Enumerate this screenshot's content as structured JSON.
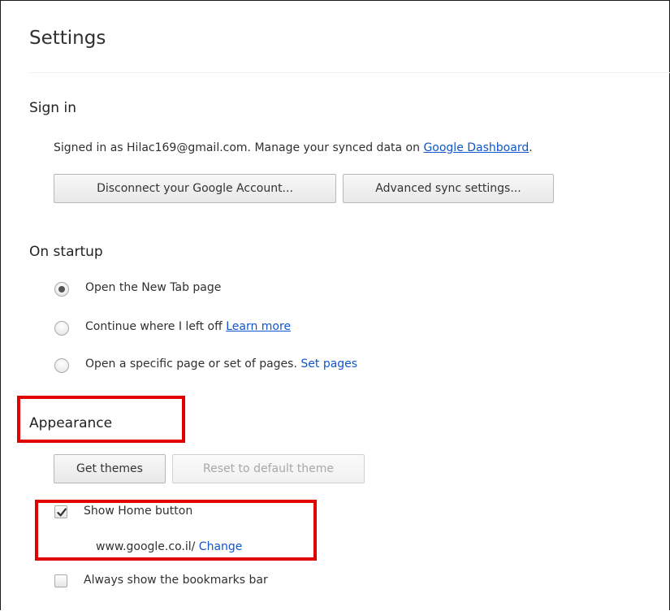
{
  "page": {
    "title": "Settings"
  },
  "sign_in": {
    "heading": "Sign in",
    "signed_in_text": "Signed in as Hilac169@gmail.com. Manage your synced data on ",
    "dashboard_link": "Google Dashboard",
    "dashboard_suffix": ".",
    "disconnect_button": "Disconnect your Google Account...",
    "advanced_sync_button": "Advanced sync settings..."
  },
  "on_startup": {
    "heading": "On startup",
    "options": [
      {
        "label": "Open the New Tab page",
        "selected": true
      },
      {
        "label": "Continue where I left off",
        "selected": false,
        "link": "Learn more"
      },
      {
        "label": "Open a specific page or set of pages.",
        "selected": false,
        "link": "Set pages"
      }
    ]
  },
  "appearance": {
    "heading": "Appearance",
    "get_themes_button": "Get themes",
    "reset_theme_button": "Reset to default theme",
    "show_home_button": {
      "label": "Show Home button",
      "checked": true
    },
    "home_url": "www.google.co.il/",
    "change_link": "Change",
    "bookmarks_bar": {
      "label": "Always show the bookmarks bar",
      "checked": false
    }
  },
  "colors": {
    "link": "#1155cc",
    "highlight": "#e00000",
    "text": "#303030"
  }
}
